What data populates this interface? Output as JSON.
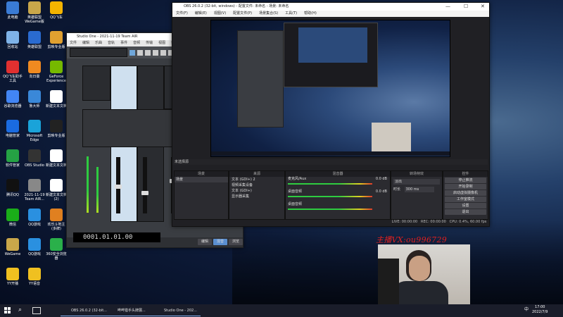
{
  "desktop": {
    "icons": [
      {
        "label": "此电脑",
        "color": "#3a7bd5"
      },
      {
        "label": "英雄联盟\nWeGame版",
        "color": "#c9a74a"
      },
      {
        "label": "QQ飞车",
        "color": "#f4b400"
      },
      {
        "label": "回收站",
        "color": "#7fb3e8"
      },
      {
        "label": "英雄联盟",
        "color": "#2a6bd0"
      },
      {
        "label": "剪映专业版",
        "color": "#e0a030"
      },
      {
        "label": "QQ飞车助手\n工具",
        "color": "#e03030"
      },
      {
        "label": "向日葵",
        "color": "#f08a20"
      },
      {
        "label": "GeForce\nExperience",
        "color": "#76b900"
      },
      {
        "label": "谷歌浏览器",
        "color": "#4285f4"
      },
      {
        "label": "鲁大师",
        "color": "#3a88d8"
      },
      {
        "label": "新建文本文档",
        "color": "#ffffff"
      },
      {
        "label": "电脑管家",
        "color": "#1a6be0"
      },
      {
        "label": "Microsoft\nEdge",
        "color": "#1aa3d9"
      },
      {
        "label": "剪映专业版",
        "color": "#222222"
      },
      {
        "label": "软件管家",
        "color": "#25a244"
      },
      {
        "label": "OBS Studio",
        "color": "#333333"
      },
      {
        "label": "新建文本文档",
        "color": "#ffffff"
      },
      {
        "label": "腾讯QQ",
        "color": "#111111"
      },
      {
        "label": "2021-11-19\nTeam AIR...",
        "color": "#888888"
      },
      {
        "label": "新建文本文档\n(2)",
        "color": "#ffffff"
      },
      {
        "label": "微信",
        "color": "#1aad19"
      },
      {
        "label": "QQ游戏",
        "color": "#2a90e0"
      },
      {
        "label": "欢乐斗地主\n(多牌)",
        "color": "#e08020"
      },
      {
        "label": "WeGame",
        "color": "#c9a74a"
      },
      {
        "label": "QQ游戏",
        "color": "#2a90e0"
      },
      {
        "label": "360安全浏览器",
        "color": "#2ab04a"
      },
      {
        "label": "YY开播",
        "color": "#f0c020"
      },
      {
        "label": "YY语音",
        "color": "#f0c020"
      }
    ]
  },
  "studio_one": {
    "title": "Studio One - 2021-11-19 Team AIR",
    "menu": [
      "文件",
      "编辑",
      "乐曲",
      "音轨",
      "事件",
      "音频",
      "传输",
      "视图",
      "帮助"
    ],
    "time": "0001.01.01.00",
    "footer": [
      "编辑",
      "混音",
      "浏览"
    ]
  },
  "obs": {
    "title": "OBS 26.0.2 (32-bit, windows) - 配置文件: 未命名 - 场景: 未命名",
    "menu": [
      "文件(F)",
      "编辑(E)",
      "视图(V)",
      "配置文件(P)",
      "场景集合(S)",
      "工具(T)",
      "帮助(H)"
    ],
    "status_label": "未选择源",
    "panels": {
      "scenes": "场景",
      "sources": "来源",
      "mixer": "混音器",
      "transitions": "转场特效",
      "controls": "控件"
    },
    "scene_item": "场景",
    "sources_list": [
      "文本 (GDI+) 2",
      "视频采集设备",
      "文本 (GDI+)",
      "显示器采集"
    ],
    "mixer": [
      {
        "name": "麦克风/Aux",
        "db": "0.0 dB"
      },
      {
        "name": "桌面音频",
        "db": "0.0 dB"
      },
      {
        "name": "桌面音频",
        "db": ""
      }
    ],
    "transition": {
      "name": "淡出",
      "duration_label": "时长",
      "duration": "300 ms"
    },
    "controls": [
      "停止推流",
      "开始录制",
      "启动虚拟摄像机",
      "工作室模式",
      "设置",
      "退出"
    ],
    "statusbar": [
      "LIVE: 00:00:00",
      "REC: 00:00:00",
      "CPU: 0.4%, 60.00 fps"
    ]
  },
  "watermark": "主播VX:ou996729",
  "taskbar": {
    "items": [
      "OBS 26.0.2 (32-bit...",
      "哔哔猎手头牌展...",
      "Studio One - 202..."
    ],
    "time": "17:00",
    "date": "2022/7/9",
    "lang": "中"
  }
}
